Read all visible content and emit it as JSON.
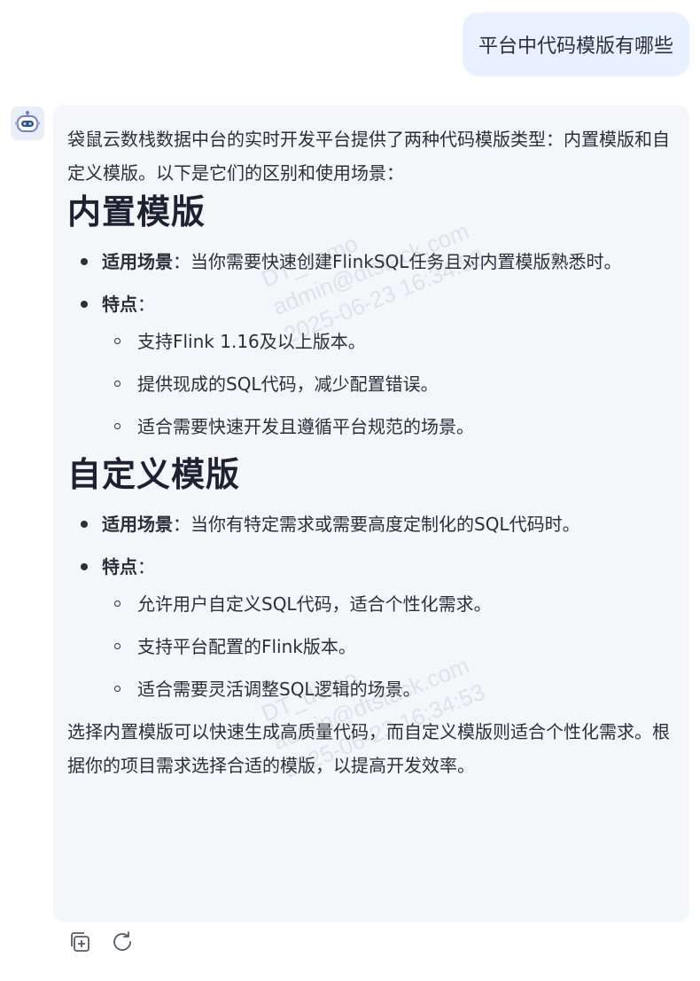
{
  "user_message": "平台中代码模版有哪些",
  "answer": {
    "intro": "袋鼠云数栈数据中台的实时开发平台提供了两种代码模版类型：内置模版和自定义模版。以下是它们的区别和使用场景：",
    "sections": [
      {
        "heading": "内置模版",
        "scenario_label": "适用场景",
        "scenario_text": "：当你需要快速创建FlinkSQL任务且对内置模版熟悉时。",
        "features_label": "特点",
        "features_colon": "：",
        "features": [
          "支持Flink 1.16及以上版本。",
          "提供现成的SQL代码，减少配置错误。",
          "适合需要快速开发且遵循平台规范的场景。"
        ]
      },
      {
        "heading": "自定义模版",
        "scenario_label": "适用场景",
        "scenario_text": "：当你有特定需求或需要高度定制化的SQL代码时。",
        "features_label": "特点",
        "features_colon": "：",
        "features": [
          "允许用户自定义SQL代码，适合个性化需求。",
          "支持平台配置的Flink版本。",
          "适合需要灵活调整SQL逻辑的场景。"
        ]
      }
    ],
    "outro": "选择内置模版可以快速生成高质量代码，而自定义模版则适合个性化需求。根据你的项目需求选择合适的模版，以提高开发效率。"
  },
  "watermark": {
    "line1": "DT_demo",
    "line2": "admin@dtstack.com",
    "line3": "2025-06-23 16:34:53"
  },
  "icons": {
    "avatar": "robot-avatar-icon",
    "copy": "copy-icon",
    "regenerate": "regenerate-icon"
  },
  "colors": {
    "user_bubble": "#e8f1ff",
    "answer_card": "#f5f6fa",
    "text": "#2b2f3a"
  }
}
